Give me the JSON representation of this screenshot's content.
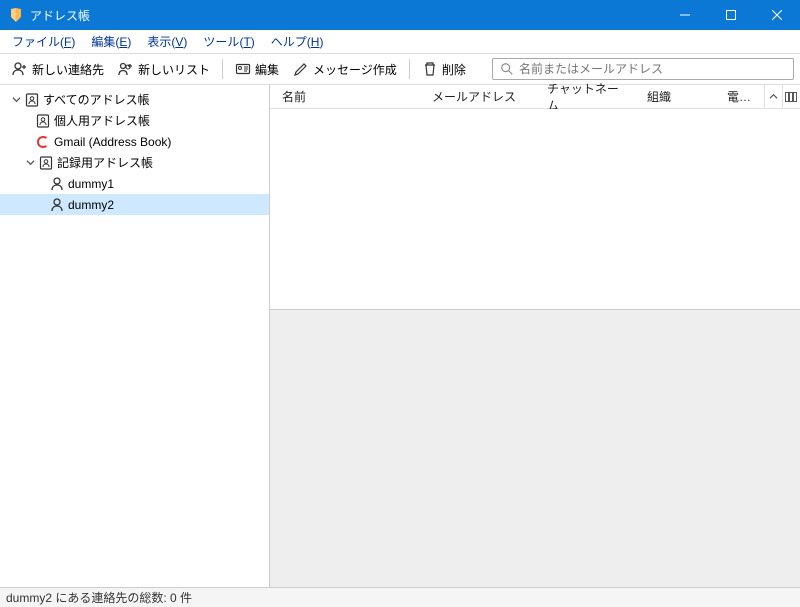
{
  "titlebar": {
    "title": "アドレス帳"
  },
  "menubar": {
    "file": {
      "label": "ファイル",
      "accel": "F"
    },
    "edit": {
      "label": "編集",
      "accel": "E"
    },
    "view": {
      "label": "表示",
      "accel": "V"
    },
    "tools": {
      "label": "ツール",
      "accel": "T"
    },
    "help": {
      "label": "ヘルプ",
      "accel": "H"
    }
  },
  "toolbar": {
    "new_contact": "新しい連絡先",
    "new_list": "新しいリスト",
    "edit": "編集",
    "compose": "メッセージ作成",
    "delete": "削除",
    "search_placeholder": "名前またはメールアドレス"
  },
  "sidebar": {
    "root": "すべてのアドレス帳",
    "personal": "個人用アドレス帳",
    "gmail": "Gmail (Address Book)",
    "recorded": "記録用アドレス帳",
    "dummy1": "dummy1",
    "dummy2": "dummy2"
  },
  "columns": {
    "name": "名前",
    "email": "メールアドレス",
    "chat": "チャットネーム",
    "org": "組織",
    "phone": "電…"
  },
  "statusbar": {
    "text": "dummy2 にある連絡先の総数: 0 件"
  }
}
